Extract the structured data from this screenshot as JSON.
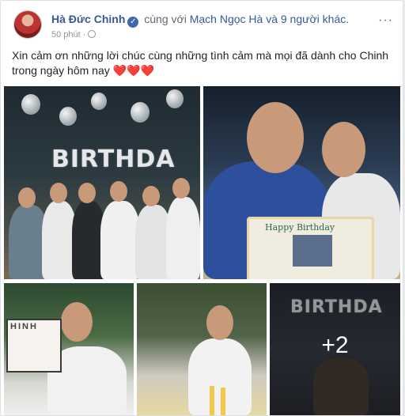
{
  "post": {
    "author": "Hà Đức Chinh",
    "with_text": "cùng với",
    "tagged_person": "Mạch Ngọc Hà",
    "others_text": "và 9 người khác.",
    "time": "50 phút",
    "text": "Xin cảm ơn những lời chúc cùng những tình cảm mà mọi đã dành cho Chinh trong ngày hôm nay",
    "hearts": "❤️❤️❤️",
    "more_menu": "···"
  },
  "photos": {
    "balloon_letters": "BIRTHDA",
    "cake_text": "Happy Birthday",
    "board_title": "HINH",
    "balloon_letters_small": "BIRTHDA",
    "more_count": "+2"
  },
  "icons": {
    "verified": "verified-badge-icon",
    "audience": "globe-icon",
    "more": "more-options-icon"
  },
  "colors": {
    "link": "#385898",
    "verified": "#4267b2",
    "heart": "#e0245e"
  }
}
